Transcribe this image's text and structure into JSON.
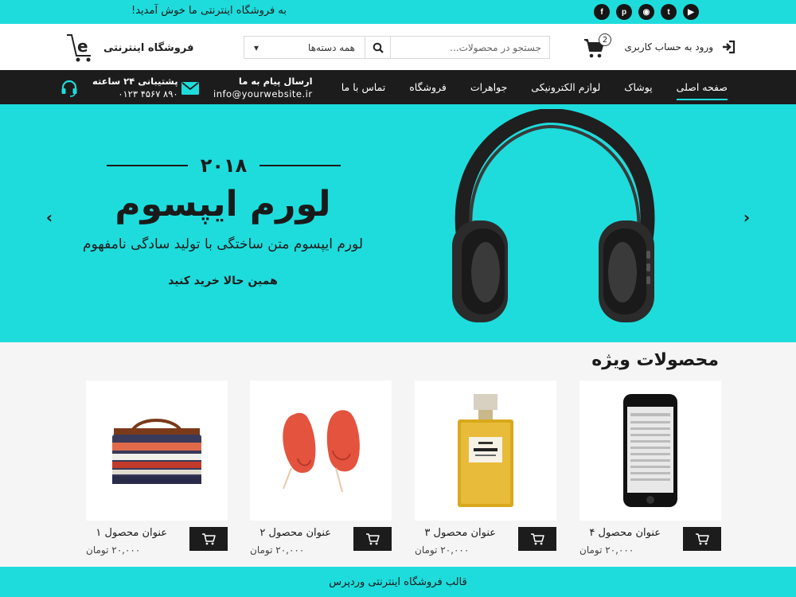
{
  "topbar": {
    "welcome": "به فروشگاه اینترنتی ما خوش آمدید!",
    "social": [
      {
        "name": "youtube-icon",
        "glyph": "▶"
      },
      {
        "name": "twitter-icon",
        "glyph": "t"
      },
      {
        "name": "rss-icon",
        "glyph": "◉"
      },
      {
        "name": "pinterest-icon",
        "glyph": "p"
      },
      {
        "name": "facebook-icon",
        "glyph": "f"
      }
    ]
  },
  "header": {
    "logo_text": "فروشگاه اینترنتی",
    "logo_letter": "e",
    "search_placeholder": "جستجو در محصولات...",
    "category_selected": "همه دسته‌ها",
    "cart_count": "2",
    "login_label": "ورود به حساب کاربری"
  },
  "nav": {
    "items": [
      "صفحه اصلی",
      "پوشاک",
      "لوازم الکترونیکی",
      "جواهرات",
      "فروشگاه",
      "تماس با ما"
    ],
    "email_title": "ارسال پیام به ما",
    "email_value": "info@yourwebsite.ir",
    "support_title": "پشتیبانی ۲۴ ساعته",
    "support_phone": "۰۱۲۳ ۴۵۶۷ ۸۹۰"
  },
  "hero": {
    "year": "۲۰۱۸",
    "title": "لورم ایپسوم",
    "subtitle": "لورم ایپسوم متن ساختگی با تولید سادگی نامفهوم",
    "cta": "همین حالا خرید کنید"
  },
  "products": {
    "section_title": "محصولات ویژه",
    "items": [
      {
        "title": "عنوان محصول ۴",
        "price": "۲۰,۰۰۰ تومان"
      },
      {
        "title": "عنوان محصول ۳",
        "price": "۲۰,۰۰۰ تومان"
      },
      {
        "title": "عنوان محصول ۲",
        "price": "۲۰,۰۰۰ تومان"
      },
      {
        "title": "عنوان محصول ۱",
        "price": "۲۰,۰۰۰ تومان"
      }
    ]
  },
  "footer": {
    "text": "قالب فروشگاه اینترنتی وردپرس"
  },
  "colors": {
    "accent": "#1edcdc",
    "dark": "#1c1c1c"
  }
}
